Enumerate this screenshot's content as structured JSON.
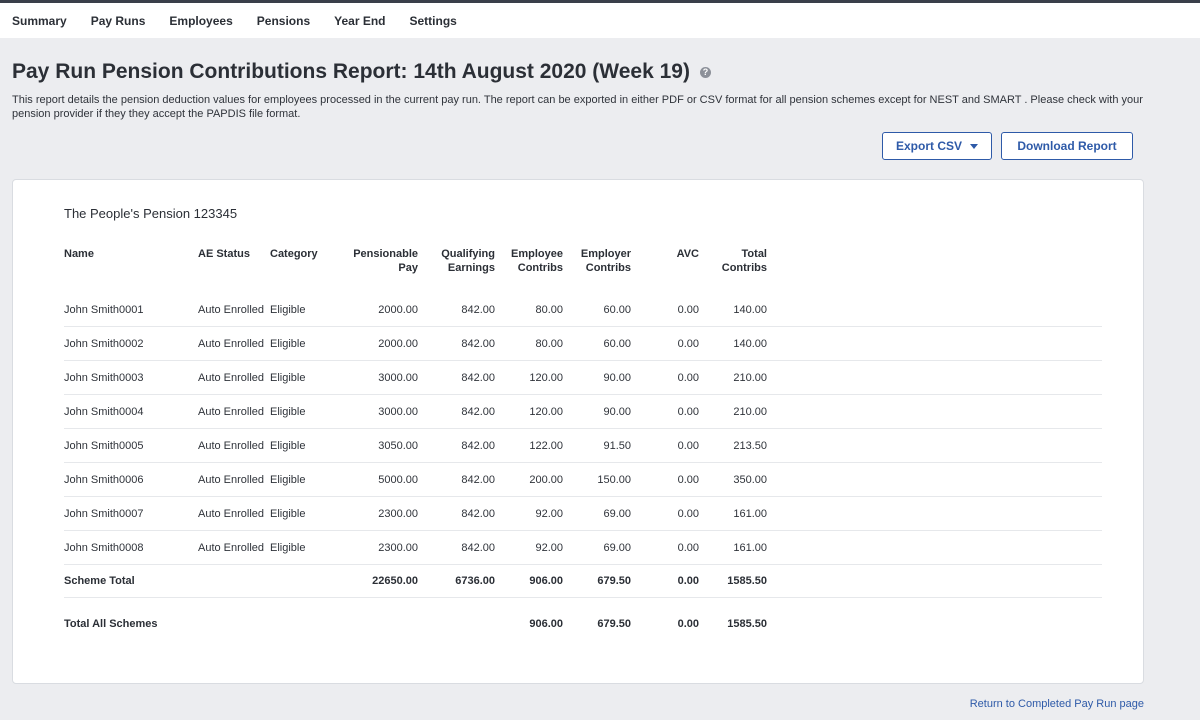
{
  "nav": [
    "Summary",
    "Pay Runs",
    "Employees",
    "Pensions",
    "Year End",
    "Settings"
  ],
  "page": {
    "title": "Pay Run Pension Contributions Report: 14th August 2020 (Week 19)",
    "description": "This report details the pension deduction values for employees processed in the current pay run. The report can be exported in either PDF or CSV format for all pension schemes except for NEST and SMART . Please check with your pension provider if they they accept the PAPDIS file format."
  },
  "actions": {
    "export_label": "Export CSV",
    "download_label": "Download Report"
  },
  "scheme": {
    "name": "The People's Pension 123345",
    "headers": {
      "name": "Name",
      "ae_status": "AE Status",
      "category": "Category",
      "pensionable_pay": [
        "Pensionable",
        "Pay"
      ],
      "qualifying_earnings": [
        "Qualifying",
        "Earnings"
      ],
      "employee_contribs": [
        "Employee",
        "Contribs"
      ],
      "employer_contribs": [
        "Employer",
        "Contribs"
      ],
      "avc": "AVC",
      "total_contribs": [
        "Total",
        "Contribs"
      ]
    },
    "rows": [
      {
        "name": "John Smith0001",
        "ae": "Auto Enrolled",
        "cat": "Eligible",
        "pp": "2000.00",
        "qe": "842.00",
        "ec": "80.00",
        "er": "60.00",
        "avc": "0.00",
        "tot": "140.00"
      },
      {
        "name": "John Smith0002",
        "ae": "Auto Enrolled",
        "cat": "Eligible",
        "pp": "2000.00",
        "qe": "842.00",
        "ec": "80.00",
        "er": "60.00",
        "avc": "0.00",
        "tot": "140.00"
      },
      {
        "name": "John Smith0003",
        "ae": "Auto Enrolled",
        "cat": "Eligible",
        "pp": "3000.00",
        "qe": "842.00",
        "ec": "120.00",
        "er": "90.00",
        "avc": "0.00",
        "tot": "210.00"
      },
      {
        "name": "John Smith0004",
        "ae": "Auto Enrolled",
        "cat": "Eligible",
        "pp": "3000.00",
        "qe": "842.00",
        "ec": "120.00",
        "er": "90.00",
        "avc": "0.00",
        "tot": "210.00"
      },
      {
        "name": "John Smith0005",
        "ae": "Auto Enrolled",
        "cat": "Eligible",
        "pp": "3050.00",
        "qe": "842.00",
        "ec": "122.00",
        "er": "91.50",
        "avc": "0.00",
        "tot": "213.50"
      },
      {
        "name": "John Smith0006",
        "ae": "Auto Enrolled",
        "cat": "Eligible",
        "pp": "5000.00",
        "qe": "842.00",
        "ec": "200.00",
        "er": "150.00",
        "avc": "0.00",
        "tot": "350.00"
      },
      {
        "name": "John Smith0007",
        "ae": "Auto Enrolled",
        "cat": "Eligible",
        "pp": "2300.00",
        "qe": "842.00",
        "ec": "92.00",
        "er": "69.00",
        "avc": "0.00",
        "tot": "161.00"
      },
      {
        "name": "John Smith0008",
        "ae": "Auto Enrolled",
        "cat": "Eligible",
        "pp": "2300.00",
        "qe": "842.00",
        "ec": "92.00",
        "er": "69.00",
        "avc": "0.00",
        "tot": "161.00"
      }
    ],
    "scheme_total": {
      "label": "Scheme Total",
      "pp": "22650.00",
      "qe": "6736.00",
      "ec": "906.00",
      "er": "679.50",
      "avc": "0.00",
      "tot": "1585.50"
    },
    "all_total": {
      "label": "Total All Schemes",
      "ec": "906.00",
      "er": "679.50",
      "avc": "0.00",
      "tot": "1585.50"
    }
  },
  "footer": {
    "return_link": "Return to Completed Pay Run page"
  },
  "colors": {
    "accent": "#2e5aa8",
    "background": "#ecedf0",
    "card": "#ffffff"
  }
}
